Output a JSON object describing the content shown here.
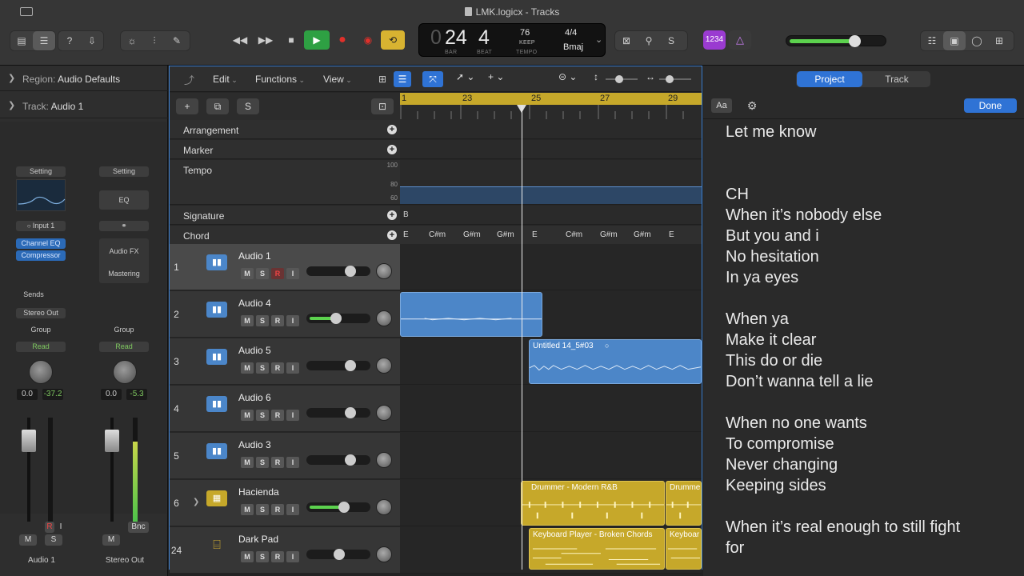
{
  "window": {
    "title": "LMK.logicx - Tracks"
  },
  "lcd": {
    "bar": "24",
    "beat": "4",
    "bar_label": "BAR",
    "beat_label": "BEAT",
    "tempo": "76",
    "keep_label": "KEEP",
    "tempo_label": "TEMPO",
    "signature": "4/4",
    "key": "Bmaj",
    "count_in": "1234"
  },
  "inspector": {
    "region": {
      "label": "Region:",
      "value": "Audio Defaults"
    },
    "track": {
      "label": "Track:",
      "value": "Audio 1"
    },
    "strip1": {
      "setting": "Setting",
      "input": "Input 1",
      "plugins": [
        "Channel EQ",
        "Compressor"
      ],
      "sends": "Sends",
      "output": "Stereo Out",
      "group": "Group",
      "automation": "Read",
      "pan_value": "0.0",
      "level": "-37.2",
      "name": "Audio 1",
      "m": "M",
      "s": "S",
      "r": "R",
      "i": "I"
    },
    "strip2": {
      "setting": "Setting",
      "eq": "EQ",
      "plugins": [
        "Audio FX",
        "Mastering"
      ],
      "group": "Group",
      "automation": "Read",
      "pan_value": "0.0",
      "level": "-5.3",
      "bnc": "Bnc",
      "name": "Stereo Out",
      "m": "M"
    }
  },
  "toolbar": {
    "edit": "Edit",
    "functions": "Functions",
    "view": "View"
  },
  "header_buttons": {
    "add": "+",
    "duplicate": "⧉",
    "solo": "S"
  },
  "ruler": {
    "bars": [
      "1",
      "23",
      "25",
      "27",
      "29"
    ]
  },
  "global_tracks": {
    "arrangement": "Arrangement",
    "marker": "Marker",
    "tempo": "Tempo",
    "tempo_ticks": [
      "100",
      "80",
      "60"
    ],
    "signature": "Signature",
    "signature_value": "B",
    "chord": "Chord",
    "chords": [
      "E",
      "C#m",
      "G#m",
      "G#m",
      "E",
      "C#m",
      "G#m",
      "G#m",
      "E"
    ]
  },
  "tracks": [
    {
      "no": "1",
      "name": "Audio 1",
      "m": "M",
      "s": "S",
      "r": "R",
      "i": "I"
    },
    {
      "no": "2",
      "name": "Audio 4",
      "m": "M",
      "s": "S",
      "r": "R",
      "i": "I"
    },
    {
      "no": "3",
      "name": "Audio 5",
      "m": "M",
      "s": "S",
      "r": "R",
      "i": "I"
    },
    {
      "no": "4",
      "name": "Audio 6",
      "m": "M",
      "s": "S",
      "r": "R",
      "i": "I"
    },
    {
      "no": "5",
      "name": "Audio 3",
      "m": "M",
      "s": "S",
      "r": "R",
      "i": "I"
    },
    {
      "no": "6",
      "name": "Hacienda",
      "m": "M",
      "s": "S",
      "r": "R",
      "i": "I"
    },
    {
      "no": "24",
      "name": "Dark Pad",
      "m": "M",
      "s": "S",
      "r": "R",
      "i": "I"
    }
  ],
  "regions": {
    "audio5": "Untitled 14_5#03",
    "drummer1": "Drummer - Modern R&B",
    "drummer2": "Drumme",
    "keys1": "Keyboard Player - Broken Chords",
    "keys2": "Keyboar"
  },
  "right_panel": {
    "tab_project": "Project",
    "tab_track": "Track",
    "font_button": "Aa",
    "done": "Done",
    "lyrics": [
      "Let me know",
      "",
      "",
      "CH",
      "When it’s nobody else",
      "But you and i",
      "No hesitation",
      "In ya eyes",
      "",
      "When ya",
      "Make it clear",
      "This do or die",
      "Don’t wanna tell a lie",
      "",
      "When no one wants",
      "To compromise",
      "Never changing",
      "Keeping sides",
      "",
      "When it’s real enough to still fight",
      "for"
    ]
  },
  "colors": {
    "accent": "#2f73d5",
    "record": "#e0302a",
    "play": "#2ea043",
    "cycle": "#d8b331",
    "region_audio": "#4c86c8",
    "region_drummer": "#c6a82a"
  }
}
